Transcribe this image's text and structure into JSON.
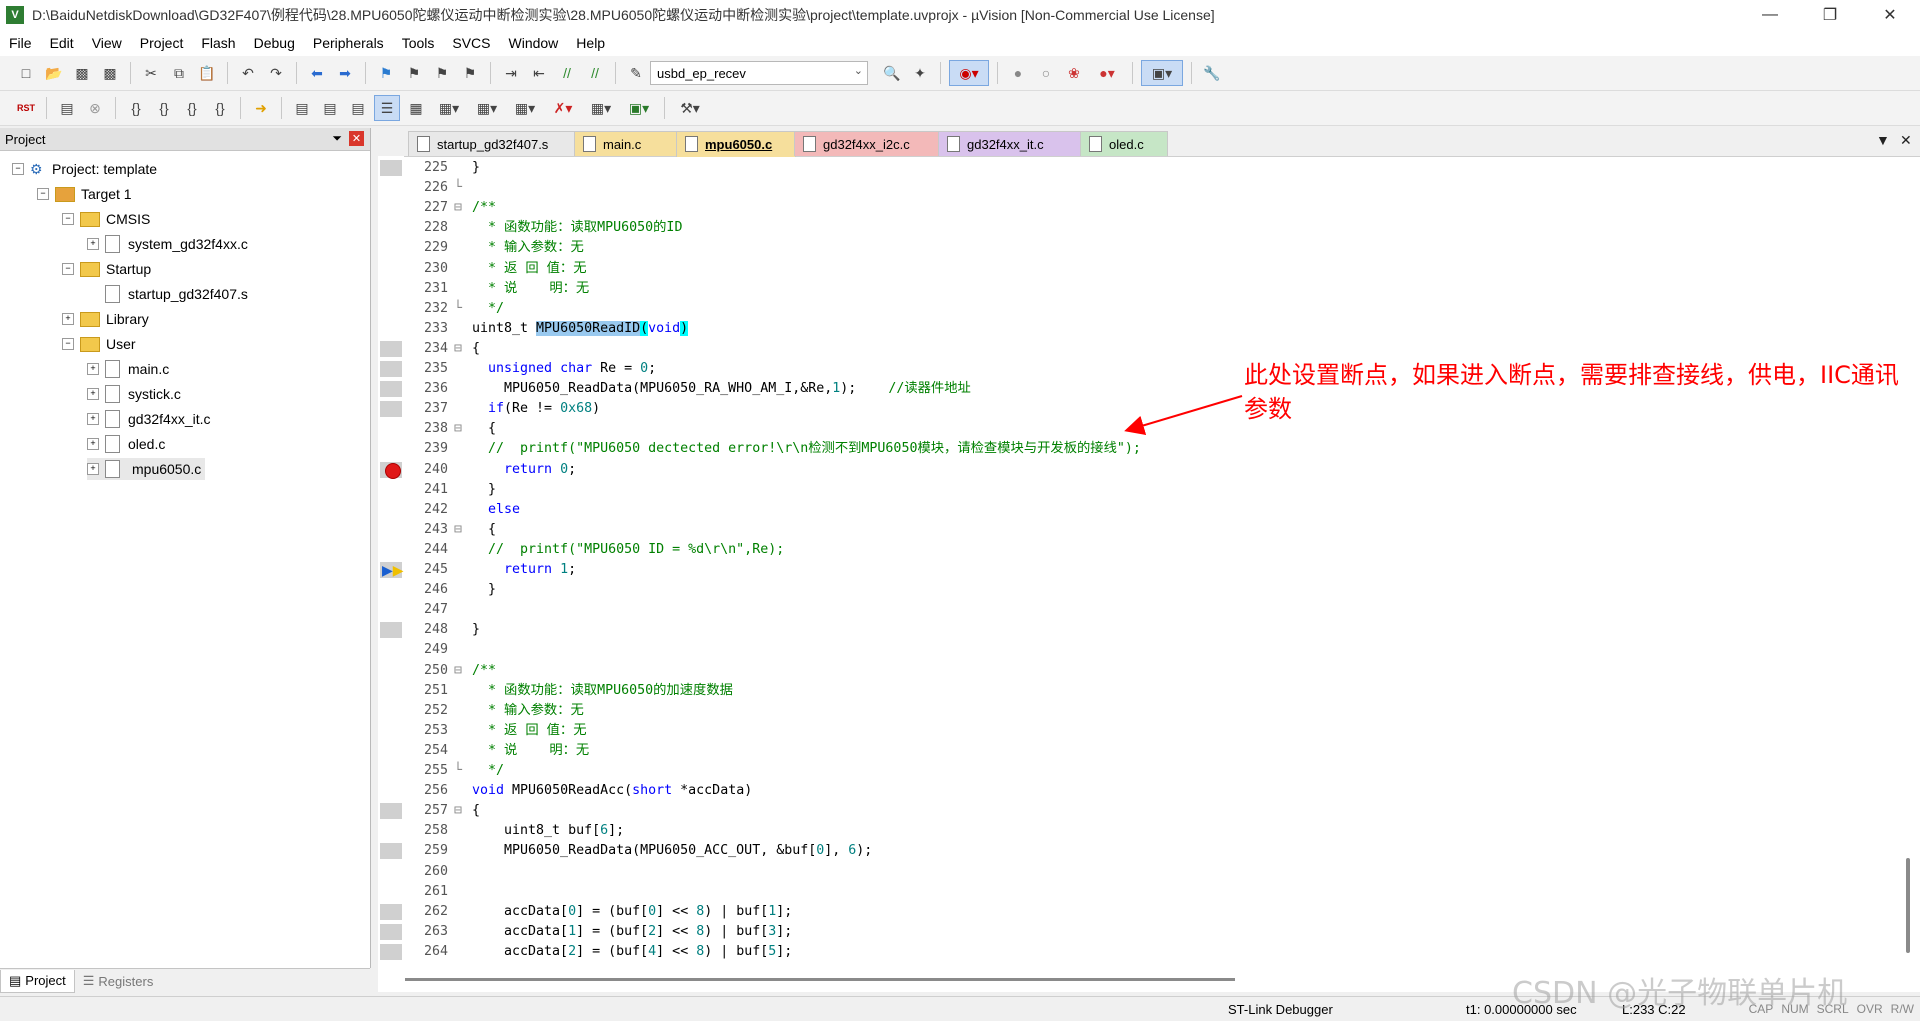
{
  "window": {
    "title": "D:\\BaiduNetdiskDownload\\GD32F407\\例程代码\\28.MPU6050陀螺仪运动中断检测实验\\28.MPU6050陀螺仪运动中断检测实验\\project\\template.uvprojx - µVision  [Non-Commercial Use License]"
  },
  "menu": [
    "File",
    "Edit",
    "View",
    "Project",
    "Flash",
    "Debug",
    "Peripherals",
    "Tools",
    "SVCS",
    "Window",
    "Help"
  ],
  "toolbar": {
    "target_combo": "usbd_ep_recev"
  },
  "project_panel": {
    "title": "Project",
    "tree": [
      {
        "label": "Project: template",
        "level": 0,
        "type": "project",
        "exp": "-"
      },
      {
        "label": "Target 1",
        "level": 1,
        "type": "target",
        "exp": "-"
      },
      {
        "label": "CMSIS",
        "level": 2,
        "type": "folder",
        "exp": "-"
      },
      {
        "label": "system_gd32f4xx.c",
        "level": 3,
        "type": "file",
        "exp": "+"
      },
      {
        "label": "Startup",
        "level": 2,
        "type": "folder",
        "exp": "-"
      },
      {
        "label": "startup_gd32f407.s",
        "level": 3,
        "type": "file",
        "exp": ""
      },
      {
        "label": "Library",
        "level": 2,
        "type": "folder",
        "exp": "+"
      },
      {
        "label": "User",
        "level": 2,
        "type": "folder",
        "exp": "-"
      },
      {
        "label": "main.c",
        "level": 3,
        "type": "file",
        "exp": "+"
      },
      {
        "label": "systick.c",
        "level": 3,
        "type": "file",
        "exp": "+"
      },
      {
        "label": "gd32f4xx_it.c",
        "level": 3,
        "type": "file",
        "exp": "+"
      },
      {
        "label": "oled.c",
        "level": 3,
        "type": "file",
        "exp": "+"
      },
      {
        "label": "mpu6050.c",
        "level": 3,
        "type": "file",
        "exp": "+",
        "selected": true
      }
    ],
    "bottom_tabs": [
      "Project",
      "Registers"
    ]
  },
  "editor_tabs": [
    {
      "label": "startup_gd32f407.s",
      "color": "#e8e8e8",
      "active": false
    },
    {
      "label": "main.c",
      "color": "#f6df9c",
      "active": false
    },
    {
      "label": "mpu6050.c",
      "color": "#f6df9c",
      "active": true
    },
    {
      "label": "gd32f4xx_i2c.c",
      "color": "#f3b9b9",
      "active": false
    },
    {
      "label": "gd32f4xx_it.c",
      "color": "#d9c2ec",
      "active": false
    },
    {
      "label": "oled.c",
      "color": "#c6e6c6",
      "active": false
    }
  ],
  "code_lines": [
    {
      "n": "225",
      "f": "",
      "t": "}"
    },
    {
      "n": "226",
      "f": "└",
      "t": ""
    },
    {
      "n": "227",
      "f": "⊟",
      "t": "/**"
    },
    {
      "n": "228",
      "f": "",
      "t": "  * 函数功能：读取MPU6050的ID"
    },
    {
      "n": "229",
      "f": "",
      "t": "  * 输入参数：无"
    },
    {
      "n": "230",
      "f": "",
      "t": "  * 返 回 值：无"
    },
    {
      "n": "231",
      "f": "",
      "t": "  * 说    明：无"
    },
    {
      "n": "232",
      "f": "└",
      "t": "  */"
    },
    {
      "n": "233",
      "f": "",
      "t": "uint8_t MPU6050ReadID(void)"
    },
    {
      "n": "234",
      "f": "⊟",
      "t": "{"
    },
    {
      "n": "235",
      "f": "",
      "t": "  unsigned char Re = 0;"
    },
    {
      "n": "236",
      "f": "",
      "t": "    MPU6050_ReadData(MPU6050_RA_WHO_AM_I,&Re,1);    //读器件地址"
    },
    {
      "n": "237",
      "f": "",
      "t": "  if(Re != 0x68)"
    },
    {
      "n": "238",
      "f": "⊟",
      "t": "  {"
    },
    {
      "n": "239",
      "f": "",
      "t": "  //  printf(\"MPU6050 dectected error!\\r\\n检测不到MPU6050模块，请检查模块与开发板的接线\");"
    },
    {
      "n": "240",
      "f": "",
      "t": "    return 0;"
    },
    {
      "n": "241",
      "f": "",
      "t": "  }"
    },
    {
      "n": "242",
      "f": "",
      "t": "  else"
    },
    {
      "n": "243",
      "f": "⊟",
      "t": "  {"
    },
    {
      "n": "244",
      "f": "",
      "t": "  //  printf(\"MPU6050 ID = %d\\r\\n\",Re);"
    },
    {
      "n": "245",
      "f": "",
      "t": "    return 1;"
    },
    {
      "n": "246",
      "f": "",
      "t": "  }"
    },
    {
      "n": "247",
      "f": "",
      "t": ""
    },
    {
      "n": "248",
      "f": "",
      "t": "}"
    },
    {
      "n": "249",
      "f": "",
      "t": ""
    },
    {
      "n": "250",
      "f": "⊟",
      "t": "/**"
    },
    {
      "n": "251",
      "f": "",
      "t": "  * 函数功能：读取MPU6050的加速度数据"
    },
    {
      "n": "252",
      "f": "",
      "t": "  * 输入参数：无"
    },
    {
      "n": "253",
      "f": "",
      "t": "  * 返 回 值：无"
    },
    {
      "n": "254",
      "f": "",
      "t": "  * 说    明：无"
    },
    {
      "n": "255",
      "f": "└",
      "t": "  */"
    },
    {
      "n": "256",
      "f": "",
      "t": "void MPU6050ReadAcc(short *accData)"
    },
    {
      "n": "257",
      "f": "⊟",
      "t": "{"
    },
    {
      "n": "258",
      "f": "",
      "t": "    uint8_t buf[6];"
    },
    {
      "n": "259",
      "f": "",
      "t": "    MPU6050_ReadData(MPU6050_ACC_OUT, &buf[0], 6);"
    },
    {
      "n": "260",
      "f": "",
      "t": ""
    },
    {
      "n": "261",
      "f": "",
      "t": ""
    },
    {
      "n": "262",
      "f": "",
      "t": "    accData[0] = (buf[0] << 8) | buf[1];"
    },
    {
      "n": "263",
      "f": "",
      "t": "    accData[1] = (buf[2] << 8) | buf[3];"
    },
    {
      "n": "264",
      "f": "",
      "t": "    accData[2] = (buf[4] << 8) | buf[5];"
    }
  ],
  "annotation": "此处设置断点，如果进入断点，需要排查接线，供电，IIC通讯参数",
  "status": {
    "debugger": "ST-Link Debugger",
    "time": "t1: 0.00000000 sec",
    "position": "L:233 C:22",
    "keys": [
      "CAP",
      "NUM",
      "SCRL",
      "OVR",
      "R/W"
    ]
  },
  "watermark": "CSDN @光子物联单片机"
}
